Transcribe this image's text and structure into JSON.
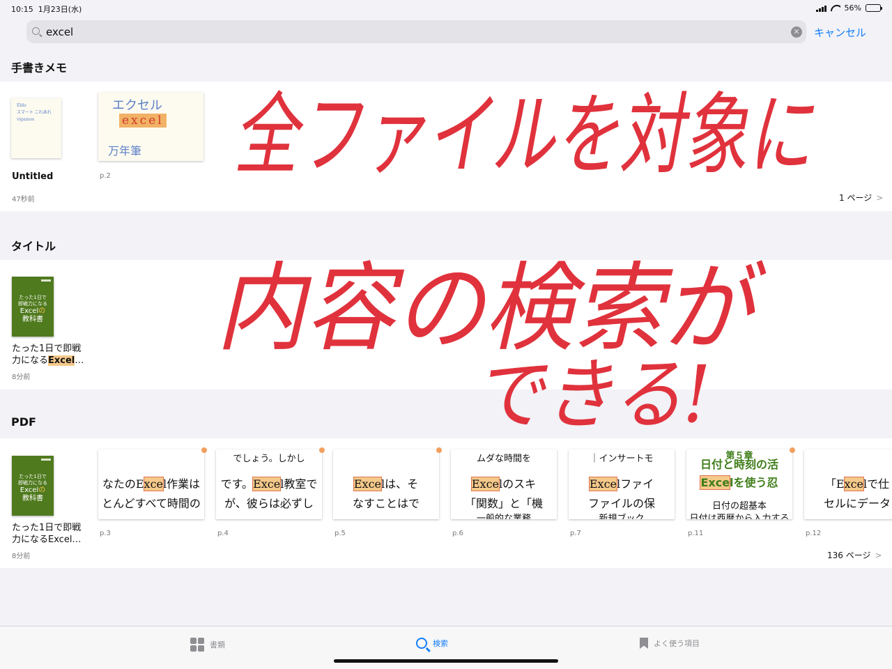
{
  "status": {
    "time": "10:15",
    "date": "1月23日(水)",
    "battery": "56%",
    "battery_level": 0.56
  },
  "search": {
    "query": "excel",
    "cancel": "キャンセル"
  },
  "handwritten_notes": {
    "header": "手書きメモ",
    "items": [
      {
        "title": "Untitled",
        "meta": "47秒前",
        "thumb_lines": [
          "Eldo",
          "スマート これあれ",
          "vigamos"
        ]
      },
      {
        "meta": "p.2",
        "thumb_lines": [
          "エクセル",
          "excel",
          "万年筆"
        ]
      }
    ],
    "more": "1 ページ"
  },
  "titles": {
    "header": "タイトル",
    "items": [
      {
        "title_pre": "たった1日で即戦力になる",
        "title_hl": "Excel",
        "title_post": "…",
        "meta": "8分前"
      }
    ]
  },
  "book_cover": {
    "line1": "たった1日で",
    "line2": "即戦力になる",
    "line3": "Excel",
    "line4": "の",
    "line5": "教科書"
  },
  "pdf": {
    "header": "PDF",
    "book": {
      "title_l1": "たった1日で即戦",
      "title_l2": "力になるExcel…",
      "meta": "8分前"
    },
    "pages": [
      {
        "label": "p.3",
        "l1": "",
        "l2_pre": "なたのE",
        "l2_hl": "xce",
        "l2_post": "l作業は",
        "l3": "とんどすべて時間の"
      },
      {
        "label": "p.4",
        "l1": "でしょう。しかし",
        "l2_pre": "です。",
        "l2_hl": "Exce",
        "l2_post": "l教室で",
        "l3": "が、彼らは必ずし"
      },
      {
        "label": "p.5",
        "l1": "",
        "l2_pre": "",
        "l2_hl": "Exce",
        "l2_post": "lは、そ",
        "l3": "なすことはで"
      },
      {
        "label": "p.6",
        "l1": "ムダな時間を",
        "l2_pre": "",
        "l2_hl": "Exce",
        "l2_post": "lのスキ",
        "l3": "「関数」と「機",
        "l4": "一般的な業務"
      },
      {
        "label": "p.7",
        "l1": "｜インサートモ",
        "l2_pre": "",
        "l2_hl": "Exce",
        "l2_post": "lファイ",
        "l3": "ファイルの保",
        "l4": "新規ブック"
      },
      {
        "label": "p.11",
        "l0": "第５章",
        "l1": "日付と時刻の活",
        "l2_pre": "",
        "l2_hl": "Exce",
        "l2_post": "lを使う忍",
        "l3": "日付の超基本",
        "l4": "日付は西暦から入力する"
      },
      {
        "label": "p.12",
        "l1": "",
        "l2_pre": "「E",
        "l2_hl": "xce",
        "l2_post": "lで仕",
        "l3": "セルにデータ"
      }
    ],
    "more": "136 ページ"
  },
  "tabbar": {
    "library": "書類",
    "search": "検索",
    "favorites": "よく使う項目"
  },
  "annotation": {
    "line1": "全ファイルを対象に",
    "line2": "内容の検索が",
    "line3": "できる!"
  },
  "colors": {
    "accent": "#147efb",
    "highlight": "#f5c98a",
    "ink": "#e0323c",
    "book": "#4f7a1e"
  }
}
